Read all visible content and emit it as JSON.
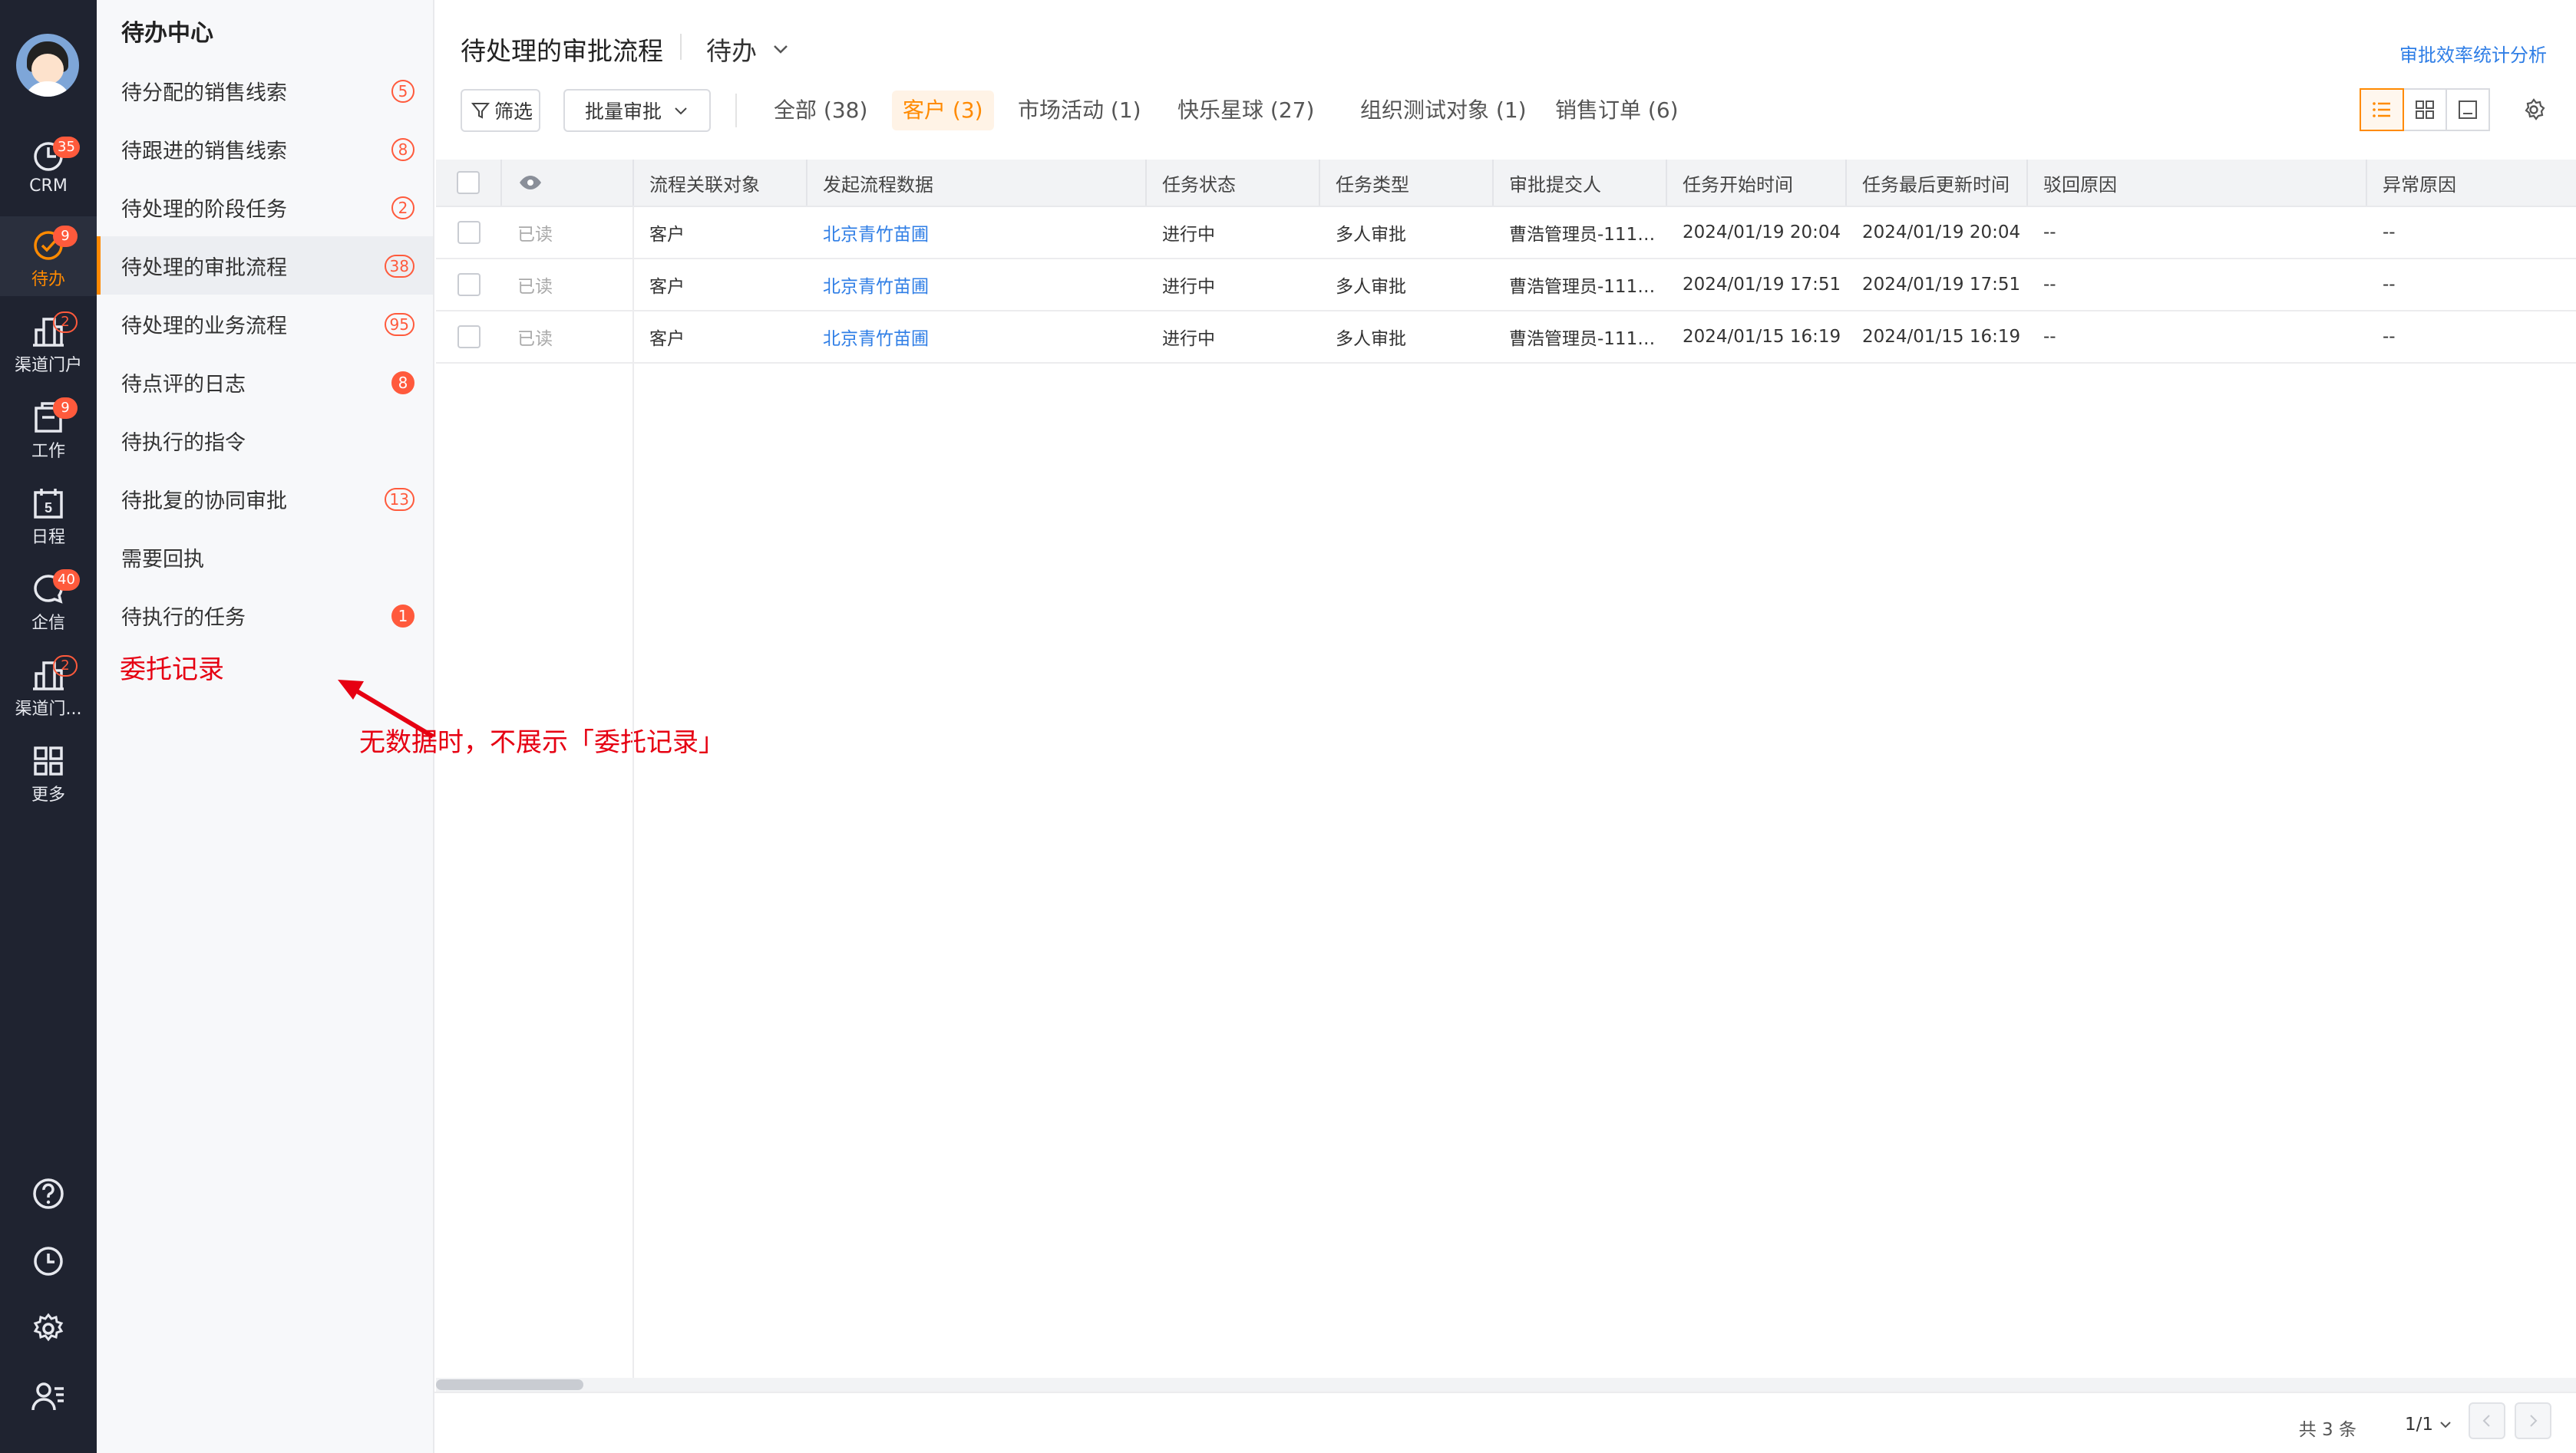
{
  "rail": {
    "items": [
      {
        "label": "CRM",
        "badge": "35"
      },
      {
        "label": "待办",
        "badge": "9"
      },
      {
        "label": "渠道门户",
        "badge": "2"
      },
      {
        "label": "工作",
        "badge": "9"
      },
      {
        "label": "日程",
        "badge": "",
        "day": "5"
      },
      {
        "label": "企信",
        "badge": "40"
      },
      {
        "label": "渠道门...",
        "badge": "2"
      },
      {
        "label": "更多",
        "badge": ""
      }
    ]
  },
  "nav": {
    "title": "待办中心",
    "items": [
      {
        "label": "待分配的销售线索",
        "badge": "5"
      },
      {
        "label": "待跟进的销售线索",
        "badge": "8"
      },
      {
        "label": "待处理的阶段任务",
        "badge": "2"
      },
      {
        "label": "待处理的审批流程",
        "badge": "38"
      },
      {
        "label": "待处理的业务流程",
        "badge": "95"
      },
      {
        "label": "待点评的日志",
        "badge": "8"
      },
      {
        "label": "待执行的指令",
        "badge": ""
      },
      {
        "label": "待批复的协同审批",
        "badge": "13"
      },
      {
        "label": "需要回执",
        "badge": ""
      },
      {
        "label": "待执行的任务",
        "badge": "1"
      }
    ],
    "delegate": "委托记录",
    "annotation": "无数据时，不展示「委托记录」"
  },
  "header": {
    "title": "待处理的审批流程",
    "view": "待办",
    "stats_link": "审批效率统计分析"
  },
  "toolbar": {
    "filter": "筛选",
    "batch": "批量审批",
    "tabs": [
      {
        "label": "全部 (38)"
      },
      {
        "label": "客户 (3)"
      },
      {
        "label": "市场活动 (1)"
      },
      {
        "label": "快乐星球 (27)"
      },
      {
        "label": "组织测试对象 (1)"
      },
      {
        "label": "销售订单 (6)"
      }
    ]
  },
  "table": {
    "columns": [
      "流程关联对象",
      "发起流程数据",
      "任务状态",
      "任务类型",
      "审批提交人",
      "任务开始时间",
      "任务最后更新时间",
      "驳回原因",
      "异常原因"
    ],
    "rows": [
      {
        "read": "已读",
        "obj": "客户",
        "data": "北京青竹苗圃",
        "status": "进行中",
        "type": "多人审批",
        "submitter": "曹浩管理员-111…",
        "start": "2024/01/19 20:04",
        "updated": "2024/01/19 20:04",
        "reject": "--",
        "exception": "--"
      },
      {
        "read": "已读",
        "obj": "客户",
        "data": "北京青竹苗圃",
        "status": "进行中",
        "type": "多人审批",
        "submitter": "曹浩管理员-111…",
        "start": "2024/01/19 17:51",
        "updated": "2024/01/19 17:51",
        "reject": "--",
        "exception": "--"
      },
      {
        "read": "已读",
        "obj": "客户",
        "data": "北京青竹苗圃",
        "status": "进行中",
        "type": "多人审批",
        "submitter": "曹浩管理员-111…",
        "start": "2024/01/15 16:19",
        "updated": "2024/01/15 16:19",
        "reject": "--",
        "exception": "--"
      }
    ]
  },
  "footer": {
    "total": "共 3 条",
    "page": "1/1"
  },
  "colors": {
    "accent": "#ff8a00",
    "badge": "#ff5a3c",
    "link": "#2f7ee6",
    "annotation": "#e60012"
  }
}
